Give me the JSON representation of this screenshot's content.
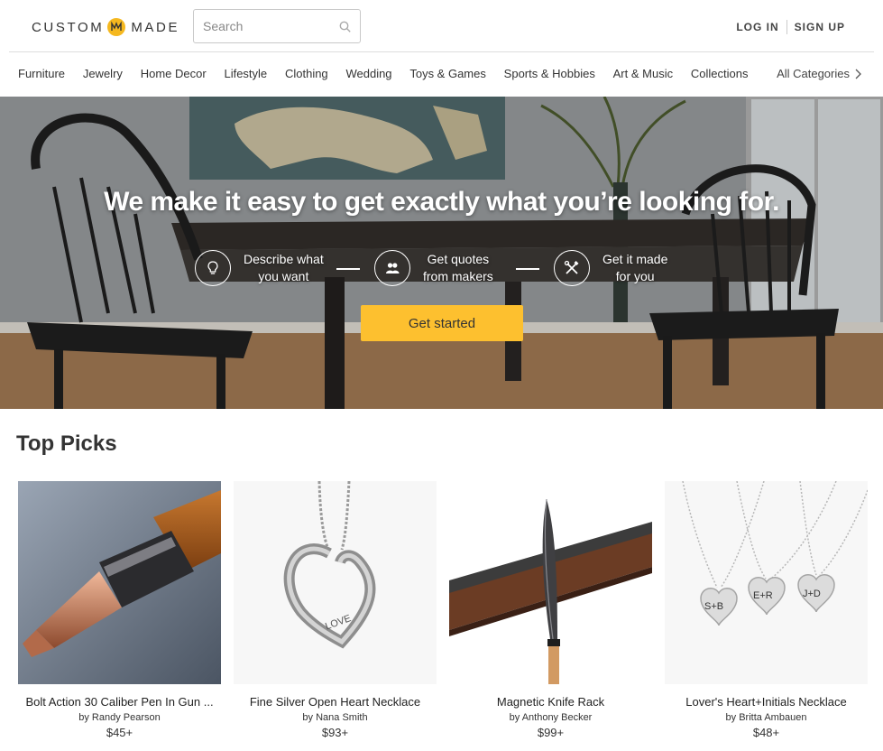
{
  "header": {
    "logo_left": "CUSTOM",
    "logo_right": "MADE",
    "logo_icon": "cm-monogram-icon",
    "search_placeholder": "Search",
    "login": "LOG IN",
    "signup": "SIGN UP",
    "brand_color": "#f5b81f"
  },
  "nav": {
    "items": [
      "Furniture",
      "Jewelry",
      "Home Decor",
      "Lifestyle",
      "Clothing",
      "Wedding",
      "Toys & Games",
      "Sports & Hobbies",
      "Art & Music",
      "Collections"
    ],
    "all_categories": "All Categories"
  },
  "hero": {
    "title": "We make it easy to get exactly what you’re looking for.",
    "steps": [
      {
        "line1": "Describe what",
        "line2": "you want",
        "icon": "lightbulb-icon"
      },
      {
        "line1": "Get quotes",
        "line2": "from makers",
        "icon": "people-icon"
      },
      {
        "line1": "Get it made",
        "line2": "for you",
        "icon": "tools-icon"
      }
    ],
    "cta": "Get started",
    "cta_color": "#fdc02f"
  },
  "top_picks": {
    "title": "Top Picks",
    "items": [
      {
        "name": "Bolt Action 30 Caliber Pen In Gun ...",
        "maker": "by Randy Pearson",
        "price": "$45+"
      },
      {
        "name": "Fine Silver Open Heart Necklace",
        "maker": "by Nana Smith",
        "price": "$93+"
      },
      {
        "name": "Magnetic Knife Rack",
        "maker": "by Anthony Becker",
        "price": "$99+"
      },
      {
        "name": "Lover's Heart+Initials Necklace",
        "maker": "by Britta Ambauen",
        "price": "$48+"
      }
    ]
  },
  "engraving": {
    "necklace": "LOVE",
    "charm1": "S+B",
    "charm2": "E+R",
    "charm3": "J+D"
  }
}
